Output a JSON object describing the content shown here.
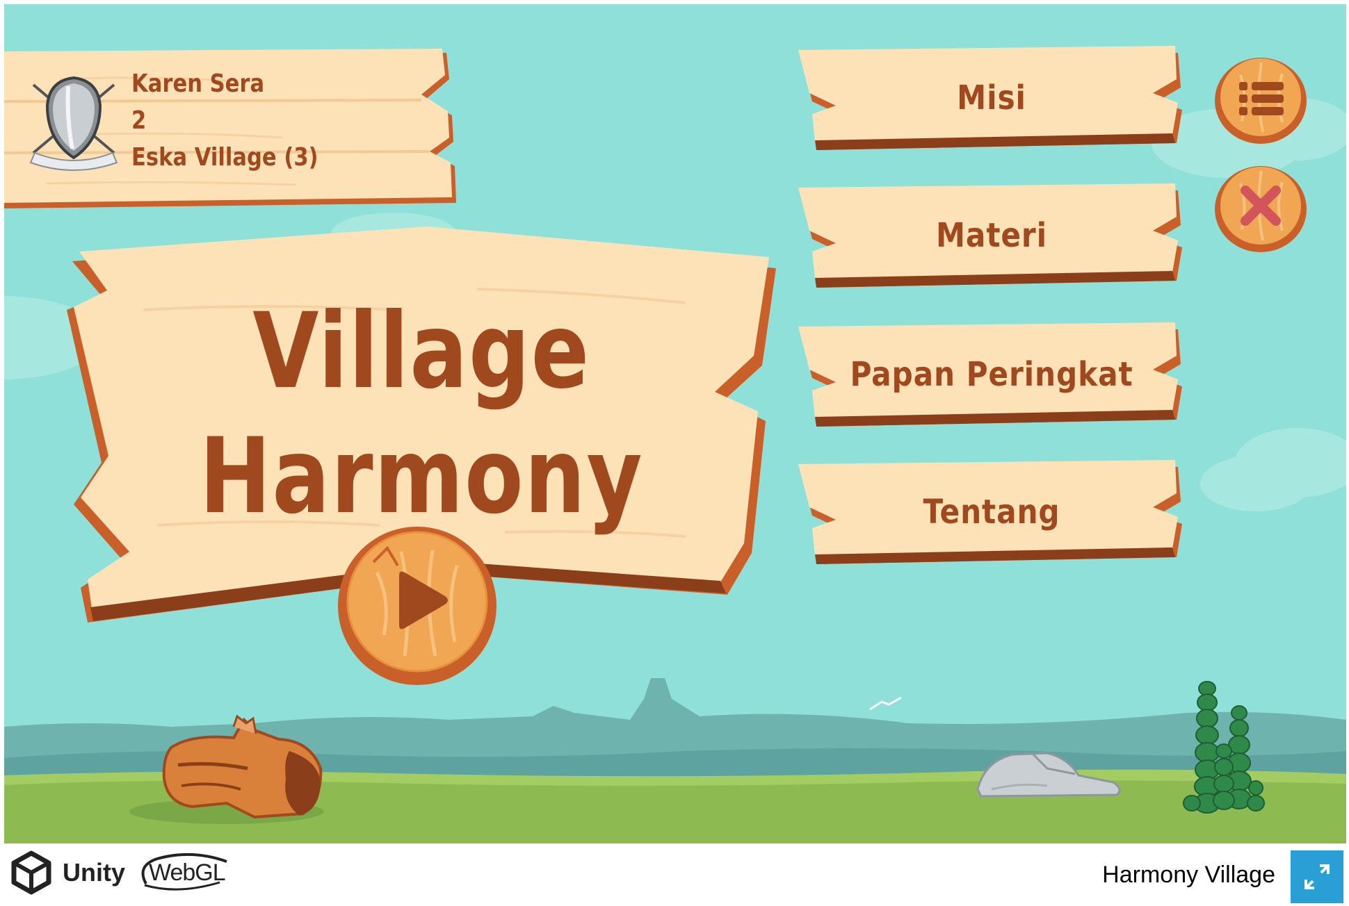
{
  "profile": {
    "name": "Karen Sera",
    "level": "2",
    "village": "Eska Village (3)"
  },
  "title": {
    "line1": "Village",
    "line2": "Harmony"
  },
  "menu": {
    "mission": "Misi",
    "material": "Materi",
    "leaderboard": "Papan Peringkat",
    "about": "Tentang"
  },
  "footer": {
    "unity_label": "Unity",
    "webgl_label": "WebGL",
    "app_title": "Harmony Village"
  },
  "colors": {
    "sky": "#8fe0d8",
    "plank_fill": "#fde2b8",
    "plank_edge": "#c9602a",
    "plank_text": "#a0491e",
    "grass": "#8dbb51",
    "fullscreen_button": "#2a9fd6"
  }
}
